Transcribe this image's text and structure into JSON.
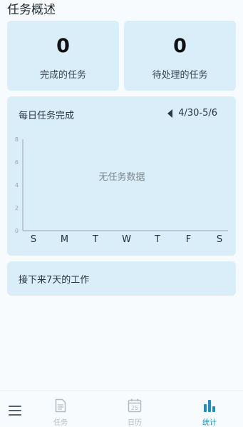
{
  "overview": {
    "title": "任务概述"
  },
  "stats": [
    {
      "value": "0",
      "label": "完成的任务"
    },
    {
      "value": "0",
      "label": "待处理的任务"
    }
  ],
  "daily_chart": {
    "title": "每日任务完成",
    "range": "4/30-5/6",
    "empty_text": "无任务数据",
    "y_ticks": [
      "0",
      "2",
      "4",
      "6",
      "8"
    ],
    "x_days": [
      "S",
      "M",
      "T",
      "W",
      "T",
      "F",
      "S"
    ]
  },
  "chart_data": {
    "type": "bar",
    "categories": [
      "S",
      "M",
      "T",
      "W",
      "T",
      "F",
      "S"
    ],
    "values": [],
    "title": "每日任务完成",
    "ylim": [
      0,
      8
    ],
    "yticks": [
      0,
      2,
      4,
      6,
      8
    ],
    "grid": false
  },
  "upcoming": {
    "label": "接下来7天的工作"
  },
  "bottom_nav": {
    "tasks_label": "任务",
    "calendar_label": "日历",
    "calendar_day": "25",
    "stats_label": "统计"
  },
  "colors": {
    "card_bg": "#d9eef8",
    "page_bg": "#f7fbfd",
    "active_tab": "#1a8fc4",
    "inactive_tab": "#b4bcc2"
  }
}
